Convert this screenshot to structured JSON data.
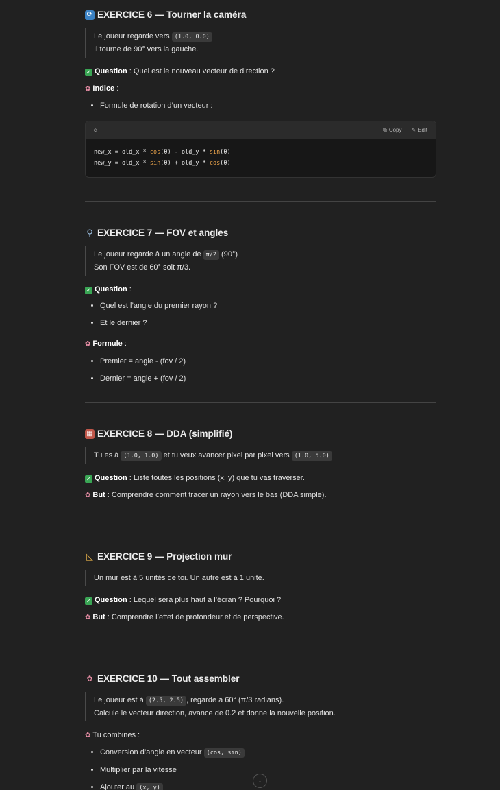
{
  "ex6": {
    "icon": "repeat-icon",
    "title": "EXERCICE 6 — Tourner la caméra",
    "quote1_pre": "Le joueur regarde vers ",
    "quote1_code": "(1.0, 0.0)",
    "quote2": "Il tourne de 90° vers la gauche.",
    "question_label": "Question",
    "question_text": " : Quel est le nouveau vecteur de direction ?",
    "hint_label": "Indice",
    "hint_text": " :",
    "bullets": [
      "Formule de rotation d’un vecteur :"
    ],
    "code": {
      "lang": "c",
      "copy_label": "Copy",
      "edit_label": "Edit",
      "l1_a": "new_x = old_x * ",
      "l1_fn1": "cos",
      "l1_b": "(θ) - old_y * ",
      "l1_fn2": "sin",
      "l1_c": "(θ)",
      "l2_a": "new_y = old_x * ",
      "l2_fn1": "sin",
      "l2_b": "(θ) + old_y * ",
      "l2_fn2": "cos",
      "l2_c": "(θ)"
    }
  },
  "ex7": {
    "icon": "magnifier-icon",
    "title": "EXERCICE 7 — FOV et angles",
    "quote1_pre": "Le joueur regarde à un angle de ",
    "quote1_code": "π/2",
    "quote1_post": " (90°)",
    "quote2": "Son FOV est de 60° soit π/3.",
    "question_label": "Question",
    "question_text": " :",
    "bullets": [
      "Quel est l’angle du premier rayon ?",
      "Et le dernier ?"
    ],
    "formula_label": "Formule",
    "formula_text": " :",
    "formula_bullets": [
      "Premier = angle - (fov / 2)",
      "Dernier = angle + (fov / 2)"
    ]
  },
  "ex8": {
    "icon": "brick-icon",
    "title": "EXERCICE 8 — DDA (simplifié)",
    "quote_pre": "Tu es à ",
    "quote_code1": "(1.0, 1.0)",
    "quote_mid": " et tu veux avancer pixel par pixel vers ",
    "quote_code2": "(1.0, 5.0)",
    "question_label": "Question",
    "question_text": " : Liste toutes les positions (x, y) que tu vas traverser.",
    "goal_label": "But",
    "goal_text": " : Comprendre comment tracer un rayon vers le bas (DDA simple)."
  },
  "ex9": {
    "icon": "triangle-ruler-icon",
    "title": "EXERCICE 9 — Projection mur",
    "quote": "Un mur est à 5 unités de toi. Un autre est à 1 unité.",
    "question_label": "Question",
    "question_text": " : Lequel sera plus haut à l’écran ? Pourquoi ?",
    "goal_label": "But",
    "goal_text": " : Comprendre l’effet de profondeur et de perspective."
  },
  "ex10": {
    "icon": "brain-icon",
    "title": "EXERCICE 10 — Tout assembler",
    "quote1_pre": "Le joueur est à ",
    "quote1_code": "(2.5, 2.5)",
    "quote1_post": ", regarde à 60° (π/3 radians).",
    "quote2": "Calcule le vecteur direction, avance de 0.2 et donne la nouvelle position.",
    "combine_text": "Tu combines :",
    "b1_pre": "Conversion d’angle en vecteur ",
    "b1_code": "(cos, sin)",
    "b2": "Multiplier par la vitesse",
    "b3_pre": "Ajouter au ",
    "b3_code": "(x, y)"
  },
  "scroll_icon": "arrow-down-icon"
}
